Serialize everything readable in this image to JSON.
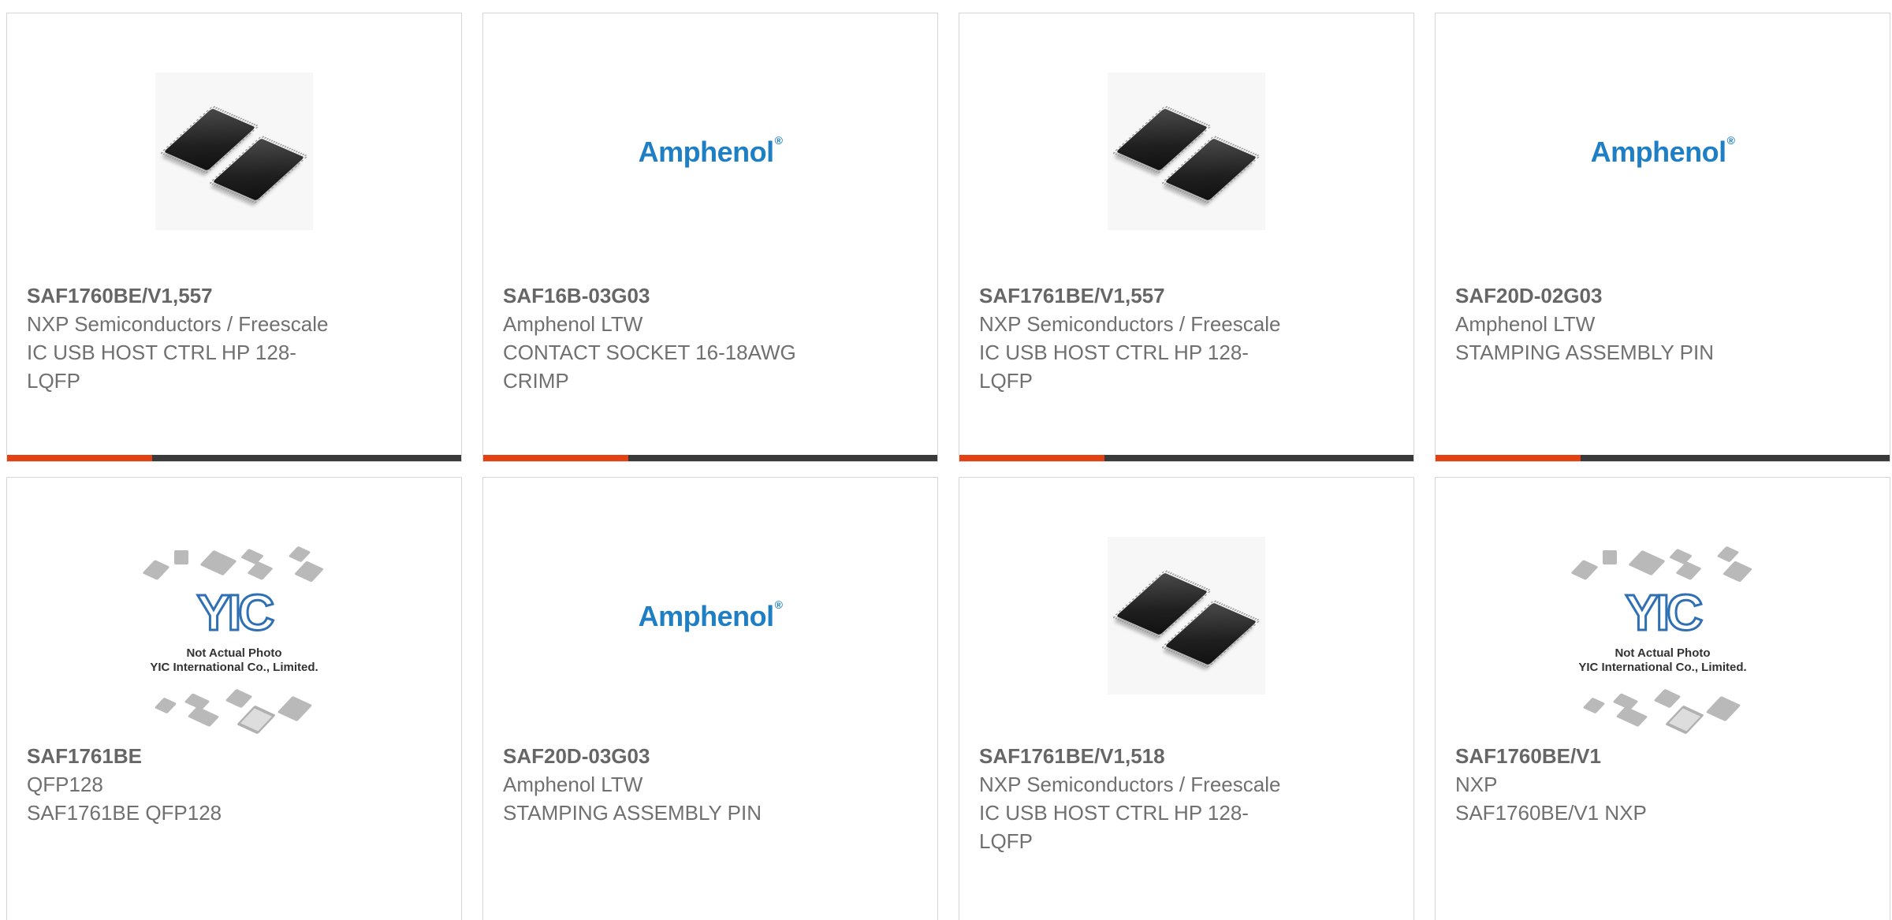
{
  "accent_color": "#e34112",
  "track_color": "#3a3a3a",
  "products": [
    {
      "part_number": "SAF1760BE/V1,557",
      "manufacturer": "NXP Semiconductors / Freescale",
      "description_line1": "IC USB HOST CTRL HP 128-",
      "description_line2": "LQFP",
      "image": "chip-photo",
      "progress_fraction": 0.32
    },
    {
      "part_number": "SAF16B-03G03",
      "manufacturer": "Amphenol LTW",
      "description_line1": "CONTACT SOCKET 16-18AWG",
      "description_line2": "CRIMP",
      "image": "amphenol-logo",
      "logo_text": "Amphenol",
      "logo_mark": "®",
      "progress_fraction": 0.32
    },
    {
      "part_number": "SAF1761BE/V1,557",
      "manufacturer": "NXP Semiconductors / Freescale",
      "description_line1": "IC USB HOST CTRL HP 128-",
      "description_line2": "LQFP",
      "image": "chip-photo",
      "progress_fraction": 0.32
    },
    {
      "part_number": "SAF20D-02G03",
      "manufacturer": "Amphenol LTW",
      "description_line1": "STAMPING ASSEMBLY PIN",
      "description_line2": "",
      "image": "amphenol-logo",
      "logo_text": "Amphenol",
      "logo_mark": "®",
      "progress_fraction": 0.32
    },
    {
      "part_number": "SAF1761BE",
      "manufacturer": "QFP128",
      "description_line1": "SAF1761BE QFP128",
      "description_line2": "",
      "image": "yic-placeholder",
      "yic_caption_1": "Not Actual Photo",
      "yic_caption_2": "YIC International Co., Limited."
    },
    {
      "part_number": "SAF20D-03G03",
      "manufacturer": "Amphenol LTW",
      "description_line1": "STAMPING ASSEMBLY PIN",
      "description_line2": "",
      "image": "amphenol-logo",
      "logo_text": "Amphenol",
      "logo_mark": "®"
    },
    {
      "part_number": "SAF1761BE/V1,518",
      "manufacturer": "NXP Semiconductors / Freescale",
      "description_line1": "IC USB HOST CTRL HP 128-",
      "description_line2": "LQFP",
      "image": "chip-photo"
    },
    {
      "part_number": "SAF1760BE/V1",
      "manufacturer": "NXP",
      "description_line1": "SAF1760BE/V1 NXP",
      "description_line2": "",
      "image": "yic-placeholder",
      "yic_caption_1": "Not Actual Photo",
      "yic_caption_2": "YIC International Co., Limited."
    }
  ]
}
